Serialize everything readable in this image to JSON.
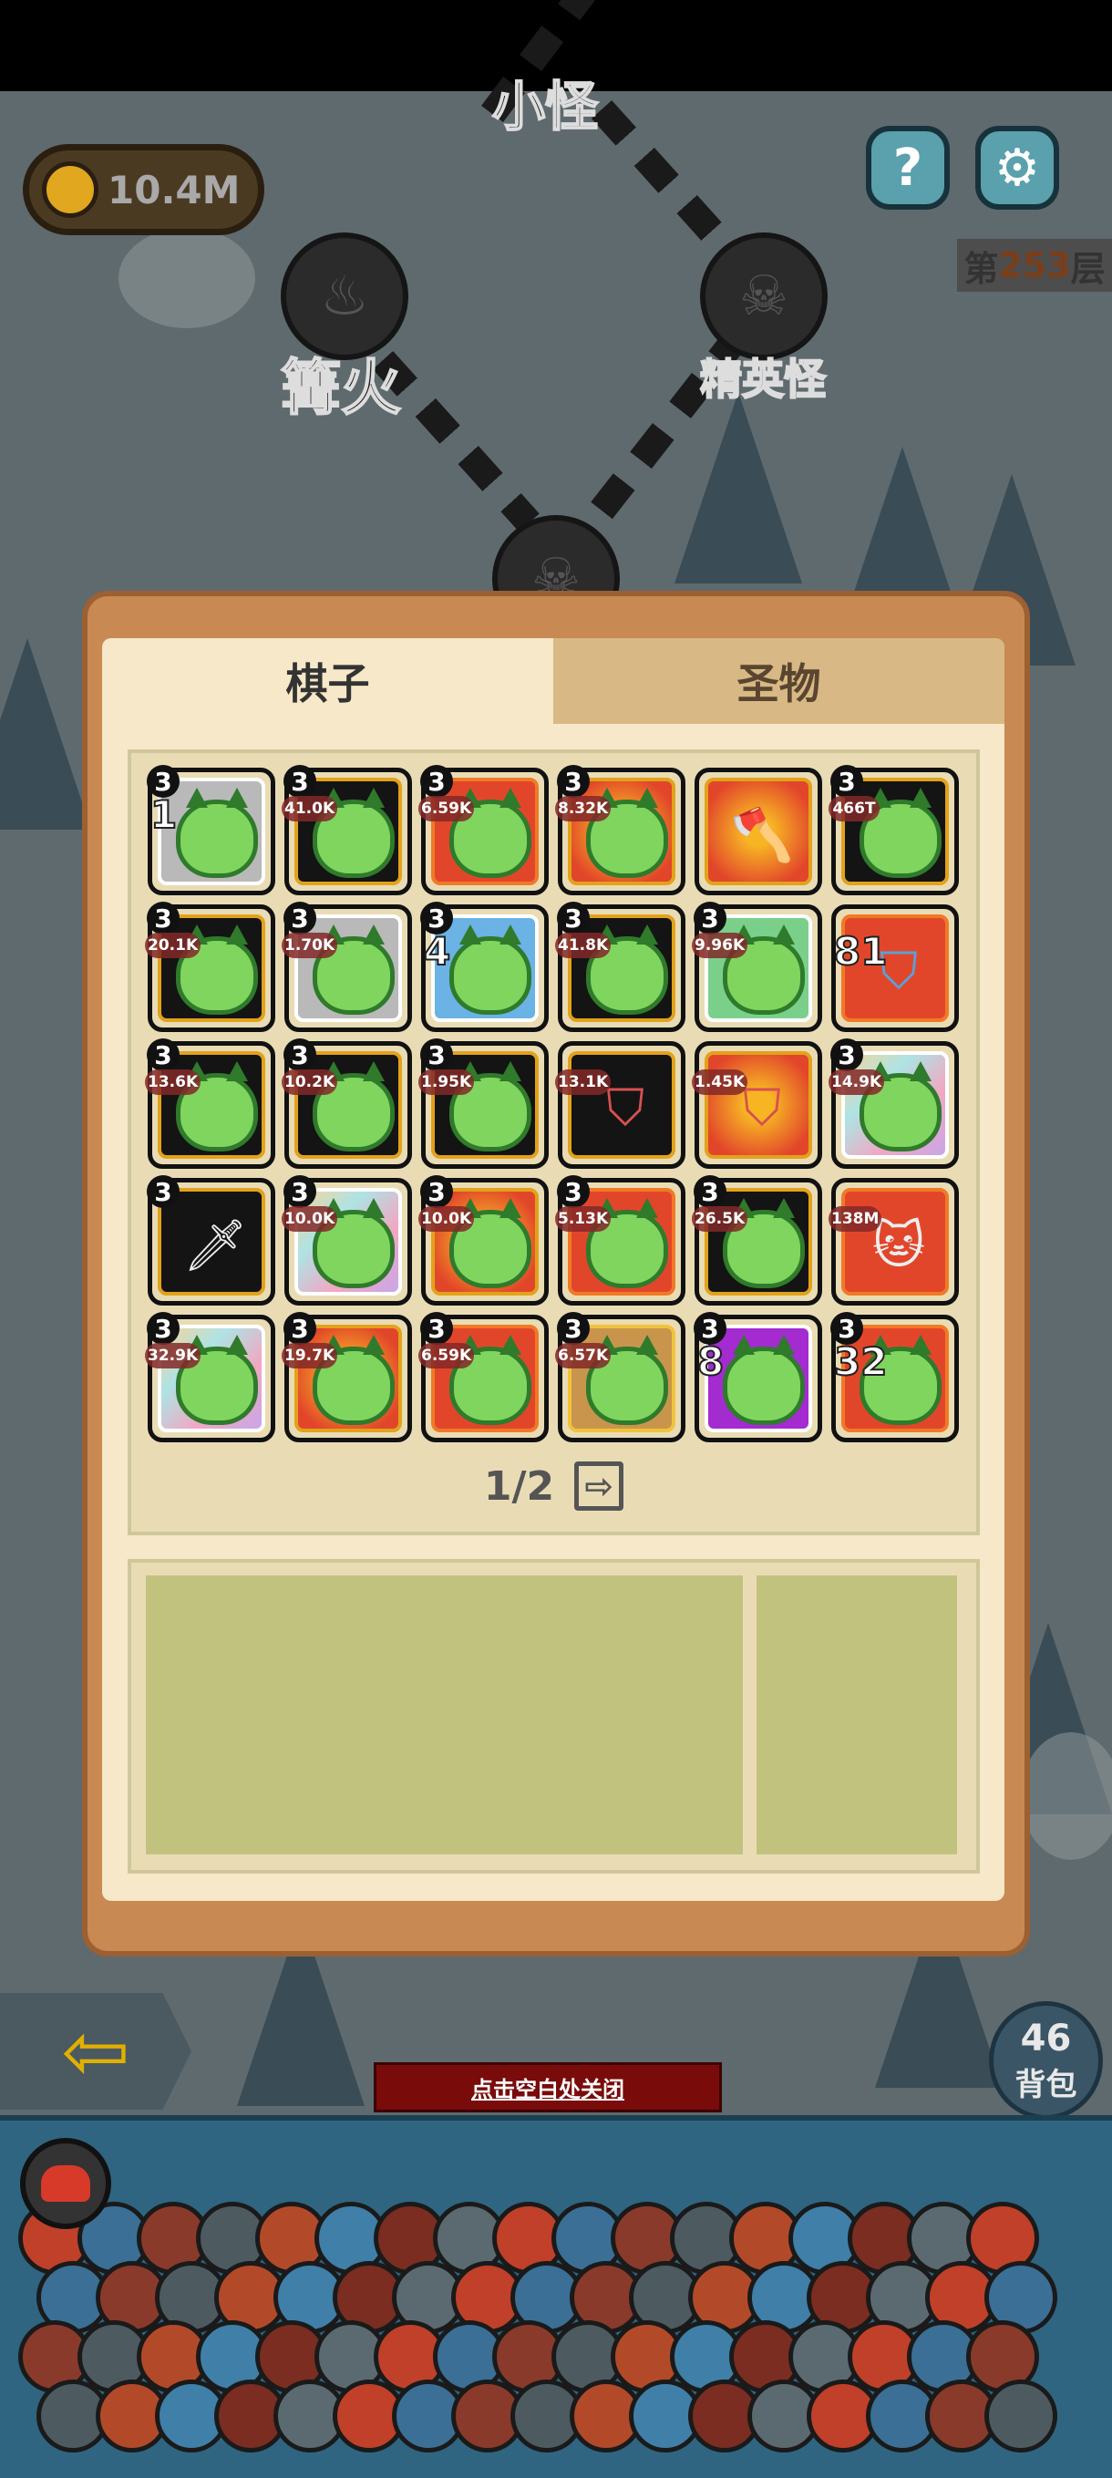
{
  "hud": {
    "coins": "10.4M",
    "floor_prefix": "第",
    "floor_number": "253",
    "floor_suffix": "层",
    "help_label": "?",
    "settings_label": "⚙"
  },
  "map": {
    "node_top_label": "小怪",
    "node_left_label": "篝火",
    "node_right_label": "精英怪"
  },
  "dialog": {
    "tabs": [
      {
        "label": "棋子"
      },
      {
        "label": "圣物"
      }
    ],
    "page": "1/2",
    "next_arrow": "⇨"
  },
  "grid": [
    [
      {
        "lvl": "3",
        "big": "1",
        "val": "",
        "frame": "gray",
        "kind": "slime"
      },
      {
        "lvl": "3",
        "big": "",
        "val": "41.0K",
        "frame": "black",
        "kind": "slime"
      },
      {
        "lvl": "3",
        "big": "",
        "val": "6.59K",
        "frame": "red",
        "kind": "slime"
      },
      {
        "lvl": "3",
        "big": "",
        "val": "8.32K",
        "frame": "fire",
        "kind": "slime"
      },
      {
        "lvl": "",
        "big": "",
        "val": "",
        "frame": "fire",
        "kind": "axe"
      },
      {
        "lvl": "3",
        "big": "",
        "val": "466T",
        "frame": "black",
        "kind": "slime"
      }
    ],
    [
      {
        "lvl": "3",
        "big": "",
        "val": "20.1K",
        "frame": "black",
        "kind": "slime"
      },
      {
        "lvl": "3",
        "big": "",
        "val": "1.70K",
        "frame": "gray",
        "kind": "slime"
      },
      {
        "lvl": "3",
        "big": "4",
        "val": "",
        "frame": "blue",
        "kind": "slime"
      },
      {
        "lvl": "3",
        "big": "",
        "val": "41.8K",
        "frame": "black",
        "kind": "slime"
      },
      {
        "lvl": "3",
        "big": "",
        "val": "9.96K",
        "frame": "green",
        "kind": "slime"
      },
      {
        "lvl": "",
        "big": "81",
        "val": "",
        "frame": "red",
        "kind": "shield-blue"
      }
    ],
    [
      {
        "lvl": "3",
        "big": "",
        "val": "13.6K",
        "frame": "black",
        "kind": "slime"
      },
      {
        "lvl": "3",
        "big": "",
        "val": "10.2K",
        "frame": "black",
        "kind": "slime"
      },
      {
        "lvl": "3",
        "big": "",
        "val": "1.95K",
        "frame": "black",
        "kind": "slime"
      },
      {
        "lvl": "",
        "big": "",
        "val": "13.1K",
        "frame": "black",
        "kind": "shield"
      },
      {
        "lvl": "",
        "big": "",
        "val": "1.45K",
        "frame": "fire",
        "kind": "shield"
      },
      {
        "lvl": "3",
        "big": "",
        "val": "14.9K",
        "frame": "rainbow",
        "kind": "slime"
      }
    ],
    [
      {
        "lvl": "3",
        "big": "",
        "val": "",
        "frame": "black",
        "kind": "sword"
      },
      {
        "lvl": "3",
        "big": "",
        "val": "10.0K",
        "frame": "rainbow",
        "kind": "slime"
      },
      {
        "lvl": "3",
        "big": "",
        "val": "10.0K",
        "frame": "fire",
        "kind": "slime"
      },
      {
        "lvl": "3",
        "big": "",
        "val": "5.13K",
        "frame": "red",
        "kind": "slime"
      },
      {
        "lvl": "3",
        "big": "",
        "val": "26.5K",
        "frame": "black",
        "kind": "slime"
      },
      {
        "lvl": "",
        "big": "",
        "val": "138M",
        "frame": "red",
        "kind": "cat"
      }
    ],
    [
      {
        "lvl": "3",
        "big": "",
        "val": "32.9K",
        "frame": "rainbow",
        "kind": "slime"
      },
      {
        "lvl": "3",
        "big": "",
        "val": "19.7K",
        "frame": "fire",
        "kind": "slime"
      },
      {
        "lvl": "3",
        "big": "",
        "val": "6.59K",
        "frame": "red",
        "kind": "slime"
      },
      {
        "lvl": "3",
        "big": "",
        "val": "6.57K",
        "frame": "tan",
        "kind": "slime"
      },
      {
        "lvl": "3",
        "big": "8",
        "val": "",
        "frame": "purple",
        "kind": "slime"
      },
      {
        "lvl": "3",
        "big": "32",
        "val": "",
        "frame": "red",
        "kind": "slime"
      }
    ]
  ],
  "footer": {
    "close_hint": "点击空白处关闭",
    "bag_count": "46",
    "bag_label": "背包",
    "back_arrow": "⇦"
  },
  "colors": {
    "accent": "#c88a52",
    "panel": "#f6e8c8",
    "close_bg": "#7a0b0b"
  }
}
